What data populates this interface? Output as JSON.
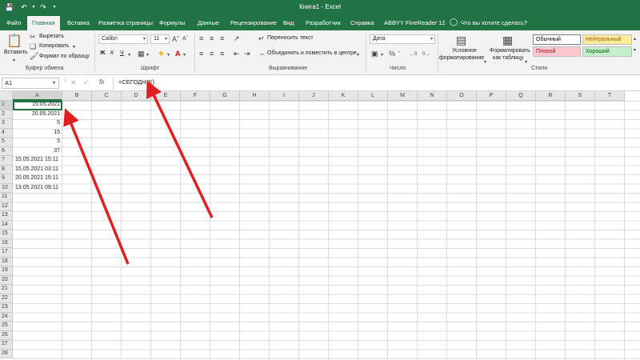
{
  "window": {
    "title": "Книга1  -  Excel"
  },
  "tabs": [
    {
      "label": "Файл"
    },
    {
      "label": "Главная"
    },
    {
      "label": "Вставка"
    },
    {
      "label": "Разметка страницы"
    },
    {
      "label": "Формулы"
    },
    {
      "label": "Данные"
    },
    {
      "label": "Рецензирование"
    },
    {
      "label": "Вид"
    },
    {
      "label": "Разработчик"
    },
    {
      "label": "Справка"
    },
    {
      "label": "ABBYY FineReader 12"
    },
    {
      "label": "Что вы хотите сделать?"
    }
  ],
  "ribbon": {
    "clipboard": {
      "paste": "Вставить",
      "cut": "Вырезать",
      "copy": "Копировать",
      "format_painter": "Формат по образцу",
      "label": "Буфер обмена"
    },
    "font": {
      "name": "Calibri",
      "size": "11",
      "bold": "Ж",
      "italic": "К",
      "underline": "Ч",
      "label": "Шрифт"
    },
    "alignment": {
      "wrap": "Переносить текст",
      "merge": "Объединить и поместить в центре",
      "label": "Выравнивание"
    },
    "number": {
      "format": "Дата",
      "label": "Число"
    },
    "styles": {
      "conditional_1": "Условное",
      "conditional_2": "форматирование",
      "table_1": "Форматировать",
      "table_2": "как таблицу",
      "normal": "Обычный",
      "neutral": "Нейтральный",
      "bad": "Плохой",
      "good": "Хороший",
      "label": "Стили"
    }
  },
  "formula_bar": {
    "name_box": "A1",
    "fx": "fx",
    "formula": "=СЕГОДНЯ()"
  },
  "columns": [
    "A",
    "B",
    "C",
    "D",
    "E",
    "F",
    "G",
    "H",
    "I",
    "J",
    "K",
    "L",
    "M",
    "N",
    "O",
    "P",
    "Q",
    "R",
    "S",
    "T"
  ],
  "rows": [
    "1",
    "2",
    "3",
    "4",
    "5",
    "6",
    "7",
    "8",
    "9",
    "10",
    "11",
    "12",
    "13",
    "14",
    "15",
    "16",
    "17",
    "18",
    "19",
    "20",
    "21",
    "22",
    "23",
    "24",
    "25",
    "26",
    "27",
    "28"
  ],
  "cells_A": [
    {
      "value": "15.05.2021",
      "align": "right"
    },
    {
      "value": "20.05.2021",
      "align": "right"
    },
    {
      "value": "5",
      "align": "right"
    },
    {
      "value": "15",
      "align": "right"
    },
    {
      "value": "5",
      "align": "right"
    },
    {
      "value": "37",
      "align": "right"
    },
    {
      "value": "15.05.2021 15:11",
      "align": "left"
    },
    {
      "value": "15.05.2021 03:11",
      "align": "left"
    },
    {
      "value": "20.05.2021 15:11",
      "align": "left"
    },
    {
      "value": "13.05.2021 09:11",
      "align": "left"
    }
  ],
  "colors": {
    "brand": "#217346",
    "arrow": "#e02020",
    "style_neutral": "#ffeb9c",
    "style_bad": "#ffc7ce",
    "style_good": "#c6efce"
  }
}
